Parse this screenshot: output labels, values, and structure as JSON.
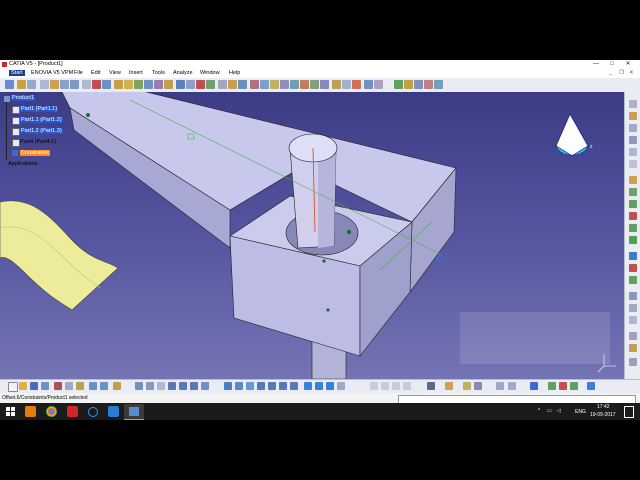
{
  "window": {
    "title": "CATIA V5 - [Product1]",
    "buttons": [
      "—",
      "□",
      "✕"
    ]
  },
  "menubar": {
    "items": [
      "Start",
      "ENOVIA V5 VPM",
      "File",
      "Edit",
      "View",
      "Insert",
      "Tools",
      "Analyze",
      "Window",
      "Help"
    ]
  },
  "tree": {
    "root": "Product1",
    "parts": [
      "Part1 (Part1.1)",
      "Part1.1 (Part1.2)",
      "Part1.2 (Part1.3)",
      "Part4 (Part4.1)"
    ],
    "constraints": "Constraints",
    "applications": "Applications"
  },
  "statusbar": {
    "message": "Offset.6/Constraints/Product1 selected"
  },
  "taskbar": {
    "language": "ENG",
    "time": "17:42",
    "date": "19-09-2017"
  },
  "colors": {
    "tree_selected": "#2a55c8",
    "constraints_highlight": "#ff8a1f",
    "viewport_top": "#3b3b86",
    "viewport_bottom": "#7474b4",
    "part_face": "#c7c7ea"
  }
}
